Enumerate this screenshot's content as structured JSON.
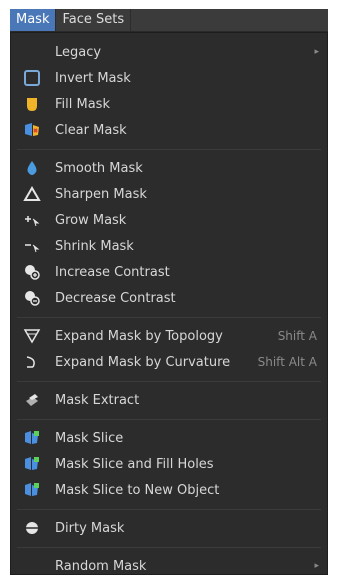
{
  "menubar": {
    "mask_label": "Mask",
    "face_sets_label": "Face Sets"
  },
  "menu": {
    "legacy": "Legacy",
    "invert_mask": "Invert Mask",
    "fill_mask": "Fill Mask",
    "clear_mask": "Clear Mask",
    "smooth_mask": "Smooth Mask",
    "sharpen_mask": "Sharpen Mask",
    "grow_mask": "Grow Mask",
    "shrink_mask": "Shrink Mask",
    "increase_contrast": "Increase Contrast",
    "decrease_contrast": "Decrease Contrast",
    "expand_topology": "Expand Mask by Topology",
    "expand_topology_shortcut": "Shift A",
    "expand_curvature": "Expand Mask by Curvature",
    "expand_curvature_shortcut": "Shift Alt A",
    "mask_extract": "Mask Extract",
    "mask_slice": "Mask Slice",
    "mask_slice_fill": "Mask Slice and Fill Holes",
    "mask_slice_new": "Mask Slice to New Object",
    "dirty_mask": "Dirty Mask",
    "random_mask": "Random Mask",
    "submenu_arrow": "▸"
  },
  "colors": {
    "accent": "#4a77b8",
    "menu_bg": "#2c2c2c",
    "text": "#d7d7d7",
    "shortcut": "#8a8a8a"
  }
}
